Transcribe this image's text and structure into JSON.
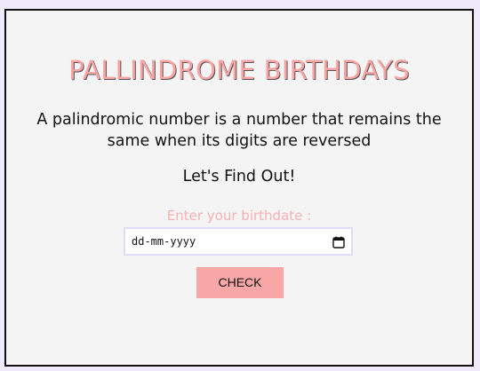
{
  "header": {
    "title": "PALLINDROME BIRTHDAYS"
  },
  "content": {
    "description_line1": "A palindromic number is a number that remains the",
    "description_line2": "same when its digits are reversed",
    "cta_text": "Let's Find Out!",
    "input_label": "Enter your birthdate :"
  },
  "date_input": {
    "placeholder": "dd-mm-yyyy",
    "icon": "calendar-icon"
  },
  "actions": {
    "check_label": "CHECK"
  },
  "colors": {
    "accent": "#f8a6a6",
    "label": "#f5b2b2",
    "page_background": "#eeeaf9",
    "card_background": "#f4f4f4"
  }
}
